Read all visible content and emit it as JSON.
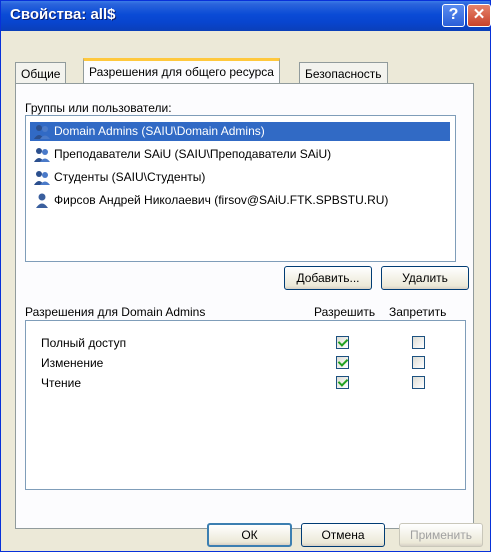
{
  "window": {
    "title": "Свойства: all$",
    "help": "?",
    "close": "✕"
  },
  "tabs": [
    {
      "label": "Общие"
    },
    {
      "label": "Разрешения для общего ресурса"
    },
    {
      "label": "Безопасность"
    }
  ],
  "groups": {
    "label": "Группы или пользователи:",
    "items": [
      {
        "label": "Domain Admins (SAIU\\Domain Admins)"
      },
      {
        "label": "Преподаватели SAiU (SAIU\\Преподаватели SAiU)"
      },
      {
        "label": "Студенты (SAIU\\Студенты)"
      },
      {
        "label": "Фирсов Андрей Николаевич (firsov@SAiU.FTK.SPBSTU.RU)"
      }
    ]
  },
  "buttons": {
    "add": "Добавить...",
    "remove": "Удалить",
    "ok": "ОК",
    "cancel": "Отмена",
    "apply": "Применить"
  },
  "permissions": {
    "label": "Разрешения для Domain Admins",
    "allow_header": "Разрешить",
    "deny_header": "Запретить",
    "rows": [
      {
        "name": "Полный доступ",
        "allow": true,
        "deny": false
      },
      {
        "name": "Изменение",
        "allow": true,
        "deny": false
      },
      {
        "name": "Чтение",
        "allow": true,
        "deny": false
      }
    ]
  },
  "colors": {
    "titlebar": "#0a4bd6",
    "selection": "#316ac5",
    "checkmark": "#21a121",
    "tab_highlight": "#ffc83d"
  }
}
